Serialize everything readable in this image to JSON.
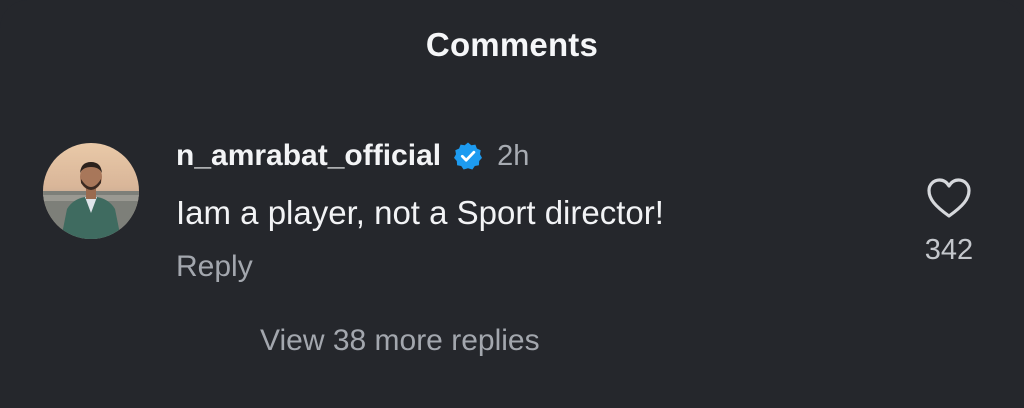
{
  "header": {
    "title": "Comments"
  },
  "comment": {
    "username": "n_amrabat_official",
    "verified": true,
    "verified_icon": "verified-badge-icon",
    "time": "2h",
    "text": "Iam a player, not a Sport director!",
    "reply_label": "Reply",
    "like_icon": "heart-outline-icon",
    "like_count": "342",
    "view_replies_label": "View 38 more replies"
  },
  "colors": {
    "background": "#25272c",
    "primary_text": "#f2f3f5",
    "secondary_text": "#a3a7ae",
    "verified_blue": "#1d9bf0"
  }
}
